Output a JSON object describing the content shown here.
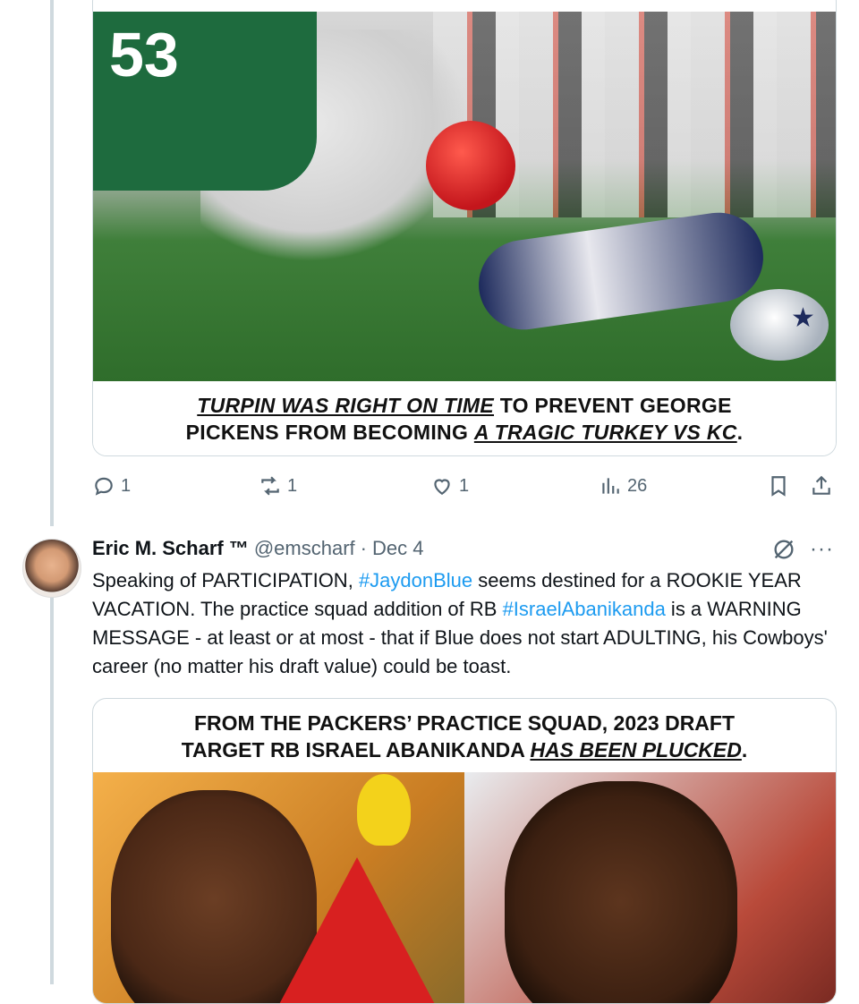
{
  "tweet1": {
    "media_caption": {
      "line1_emph": "TURPIN WAS RIGHT ON TIME",
      "line1_rest": " TO PREVENT GEORGE",
      "line2_rest": "PICKENS FROM BECOMING ",
      "line2_emph": "A TRAGIC TURKEY VS KC",
      "line2_end": "."
    },
    "jersey_number": "53",
    "actions": {
      "replies": "1",
      "reposts": "1",
      "likes": "1",
      "views": "26"
    }
  },
  "tweet2": {
    "author_name": "Eric M. Scharf ™",
    "handle": "@emscharf",
    "separator": "·",
    "date": "Dec 4",
    "more_label": "···",
    "text": {
      "p1": "Speaking of PARTICIPATION, ",
      "tag1": "#JaydonBlue",
      "p2": " seems destined for a ROOKIE YEAR VACATION. The practice squad addition of RB ",
      "tag2": "#IsraelAbanikanda",
      "p3": " is a WARNING MESSAGE - at least or at most - that if Blue does not start ADULTING, his Cowboys' career (no matter his draft value) could be toast."
    },
    "media_caption": {
      "line1": "FROM THE PACKERS’ PRACTICE SQUAD, 2023 DRAFT",
      "line2_rest": "TARGET RB ISRAEL ABANIKANDA ",
      "line2_emph": "HAS BEEN PLUCKED",
      "line2_end": "."
    }
  },
  "colors": {
    "link": "#1d9bf0",
    "secondary_text": "#536471",
    "border": "#cfd9de"
  },
  "icons": [
    "reply-icon",
    "repost-icon",
    "like-icon",
    "views-icon",
    "bookmark-icon",
    "share-icon",
    "grok-icon",
    "more-icon"
  ]
}
